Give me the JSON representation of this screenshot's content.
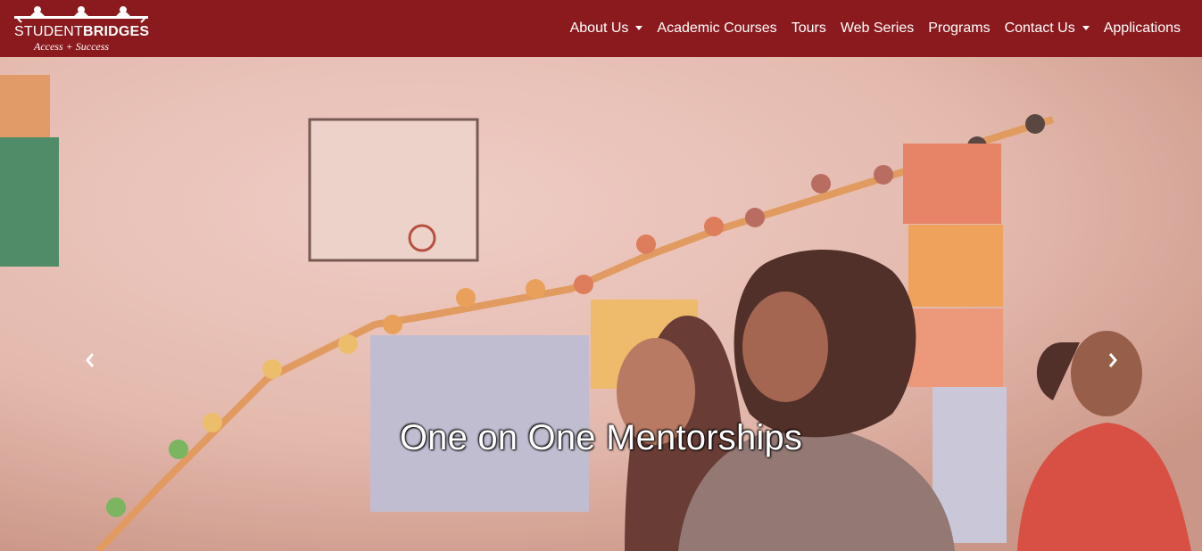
{
  "brand": {
    "name_part1": "STUDENT",
    "name_part2": "BRIDGES",
    "tagline": "Access + Success"
  },
  "nav": {
    "items": [
      {
        "label": "About Us",
        "dropdown": true
      },
      {
        "label": "Academic Courses",
        "dropdown": false
      },
      {
        "label": "Tours",
        "dropdown": false
      },
      {
        "label": "Web Series",
        "dropdown": false
      },
      {
        "label": "Programs",
        "dropdown": false
      },
      {
        "label": "Contact Us",
        "dropdown": true
      },
      {
        "label": "Applications",
        "dropdown": false
      }
    ]
  },
  "hero": {
    "caption": "One on One Mentorships",
    "prev_icon": "chevron-left-icon",
    "next_icon": "chevron-right-icon"
  },
  "colors": {
    "navbar": "#8a1a1d",
    "text": "#ffffff"
  }
}
